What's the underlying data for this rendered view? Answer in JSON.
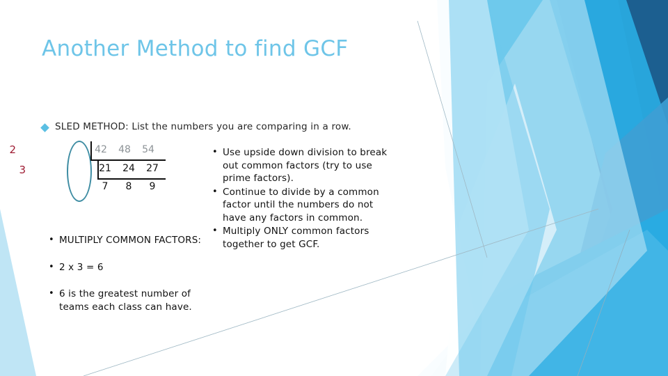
{
  "slide": {
    "title": "Another Method to find GCF",
    "title_color": "#6EC5E8",
    "background_color": "#FFFFFF"
  },
  "lead": {
    "bullet_icon": "diamond-bullet-icon",
    "text": "SLED METHOD:  List the numbers you are comparing in a row."
  },
  "sled_work": {
    "divisor_color": "#9E1B32",
    "highlight_oval_color": "#3F8DA3",
    "divisors": [
      "2",
      "3"
    ],
    "rows": [
      {
        "label": "original-numbers",
        "values": [
          "42",
          "48",
          "54"
        ],
        "color": "#8C9296"
      },
      {
        "label": "after-dividing-by-2",
        "values": [
          "21",
          "24",
          "27"
        ],
        "color": "#111111"
      },
      {
        "label": "after-dividing-by-3",
        "values": [
          "7",
          "8",
          "9"
        ],
        "color": "#111111"
      }
    ]
  },
  "left_column": {
    "bullets": [
      "MULTIPLY COMMON FACTORS:",
      "2 x 3 = 6",
      "6 is the greatest number of teams each class can have."
    ]
  },
  "right_column": {
    "bullets": [
      "Use upside down division to break out common factors (try to use prime factors).",
      "Continue to divide by a common factor until the numbers do not have any factors in common.",
      "Multiply ONLY common factors together to get GCF."
    ]
  },
  "decor": {
    "colors": {
      "pale_cyan": "#DCF1FA",
      "light_cyan": "#A8DDF2",
      "sky": "#6EC9EC",
      "bright_cyan": "#29ABE2",
      "mid_blue": "#3E9FD4",
      "steel_blue": "#2E84BE",
      "deep_blue": "#236FA6",
      "navy": "#1C5F90",
      "hairline": "#9FB8C4"
    }
  }
}
